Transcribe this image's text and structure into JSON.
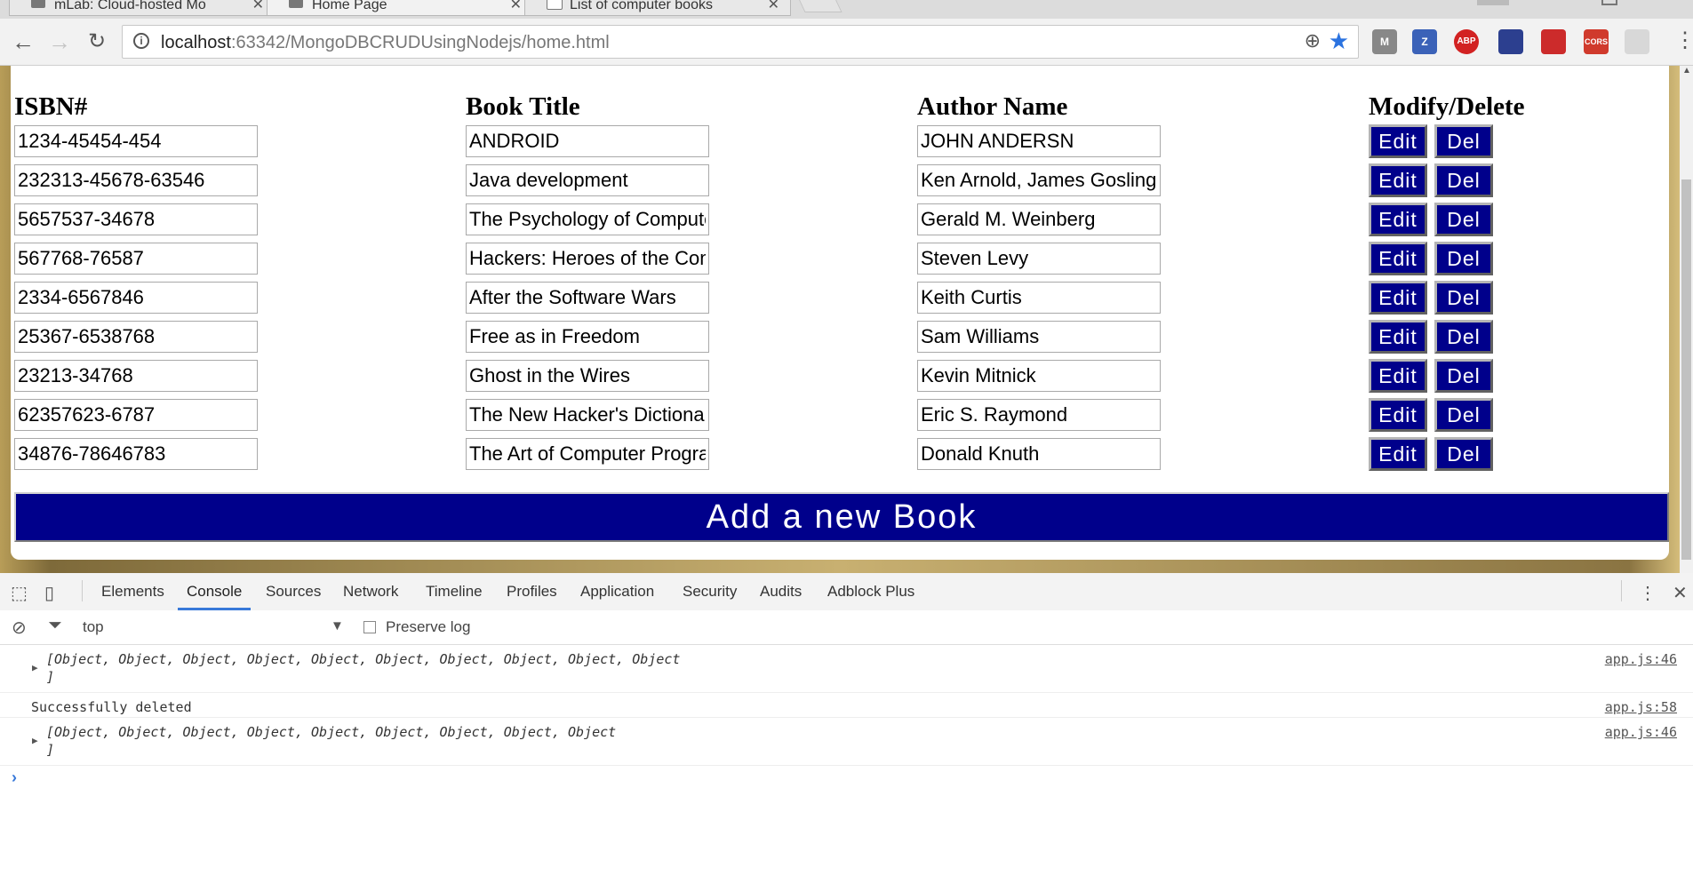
{
  "browser": {
    "tabs": [
      {
        "title": "mLab: Cloud-hosted Mo",
        "active": false
      },
      {
        "title": "Home Page",
        "active": true
      },
      {
        "title": "List of computer books",
        "active": false
      }
    ],
    "url_host": "localhost",
    "url_path": ":63342/MongoDBCRUDUsingNodejs/home.html",
    "extensions": [
      {
        "name": "shield-extension",
        "label": "M",
        "color": "#888888"
      },
      {
        "name": "zotero-extension",
        "label": "Z",
        "color": "#3b62b8"
      },
      {
        "name": "adblock-plus-extension",
        "label": "ABP",
        "color": "#d22222"
      },
      {
        "name": "tampermonkey-extension",
        "label": "",
        "color": "#2c3f8f"
      },
      {
        "name": "bookmark-extension",
        "label": "",
        "color": "#cc2b2b"
      },
      {
        "name": "cors-extension",
        "label": "CORS",
        "color": "#d03a2c"
      },
      {
        "name": "loading-extension",
        "label": "",
        "color": "#d8d8d8"
      }
    ]
  },
  "page": {
    "headers": {
      "isbn": "ISBN#",
      "title": "Book Title",
      "author": "Author Name",
      "actions": "Modify/Delete"
    },
    "books": [
      {
        "isbn": "1234-45454-454",
        "title": "ANDROID",
        "author": "JOHN ANDERSN"
      },
      {
        "isbn": "232313-45678-63546",
        "title": "Java development",
        "author": "Ken Arnold, James Gosling"
      },
      {
        "isbn": "5657537-34678",
        "title": "The Psychology of Computer Programming",
        "author": "Gerald M. Weinberg"
      },
      {
        "isbn": "567768-76587",
        "title": "Hackers: Heroes of the Computer Revolution",
        "author": "Steven Levy"
      },
      {
        "isbn": "2334-6567846",
        "title": "After the Software Wars",
        "author": "Keith Curtis"
      },
      {
        "isbn": "25367-6538768",
        "title": "Free as in Freedom",
        "author": "Sam Williams"
      },
      {
        "isbn": "23213-34768",
        "title": "Ghost in the Wires",
        "author": "Kevin Mitnick"
      },
      {
        "isbn": "62357623-6787",
        "title": "The New Hacker's Dictionary",
        "author": "Eric S. Raymond"
      },
      {
        "isbn": "34876-78646783",
        "title": "The Art of Computer Programming",
        "author": "Donald Knuth"
      }
    ],
    "edit_label": "Edit",
    "delete_label": "Del",
    "add_button_label": "Add a new Book"
  },
  "devtools": {
    "tabs": [
      "Elements",
      "Console",
      "Sources",
      "Network",
      "Timeline",
      "Profiles",
      "Application",
      "Security",
      "Audits",
      "Adblock Plus"
    ],
    "active_tab": "Console",
    "context": "top",
    "preserve_log_label": "Preserve log",
    "logs": [
      {
        "expandable": true,
        "line1": "[Object, Object, Object, Object, Object, Object, Object, Object, Object, Object",
        "line2": "]",
        "source": "app.js:46"
      },
      {
        "expandable": false,
        "line1": "Successfully deleted",
        "line2": "",
        "source": "app.js:58"
      },
      {
        "expandable": true,
        "line1": "[Object, Object, Object, Object, Object, Object, Object, Object, Object",
        "line2": "]",
        "source": "app.js:46"
      }
    ]
  }
}
